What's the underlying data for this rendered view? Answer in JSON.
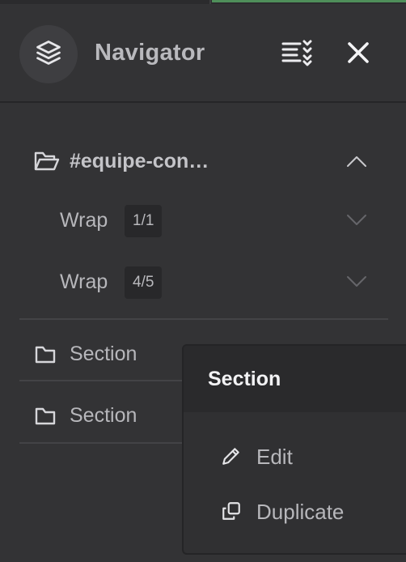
{
  "header": {
    "title": "Navigator",
    "layers_icon": "layers-icon",
    "collapse_all_icon": "list-collapse-icon",
    "close_icon": "close-icon"
  },
  "tree": {
    "root": {
      "label": "#equipe-con…",
      "icon": "folder-open-icon",
      "chevron": "chevron-up-icon",
      "children": [
        {
          "label": "Wrap",
          "badge": "1/1",
          "chevron": "chevron-down-icon"
        },
        {
          "label": "Wrap",
          "badge": "4/5",
          "chevron": "chevron-down-icon"
        }
      ]
    },
    "sections": [
      {
        "label": "Section",
        "icon": "folder-icon"
      },
      {
        "label": "Section",
        "icon": "folder-icon"
      }
    ]
  },
  "context_menu": {
    "title": "Section",
    "items": [
      {
        "label": "Edit",
        "icon": "pencil-icon"
      },
      {
        "label": "Duplicate",
        "icon": "duplicate-icon"
      }
    ]
  },
  "colors": {
    "background": "#333335",
    "accent": "#4f8f5a",
    "menu_background": "#303032",
    "menu_header": "#2a2a2c"
  }
}
